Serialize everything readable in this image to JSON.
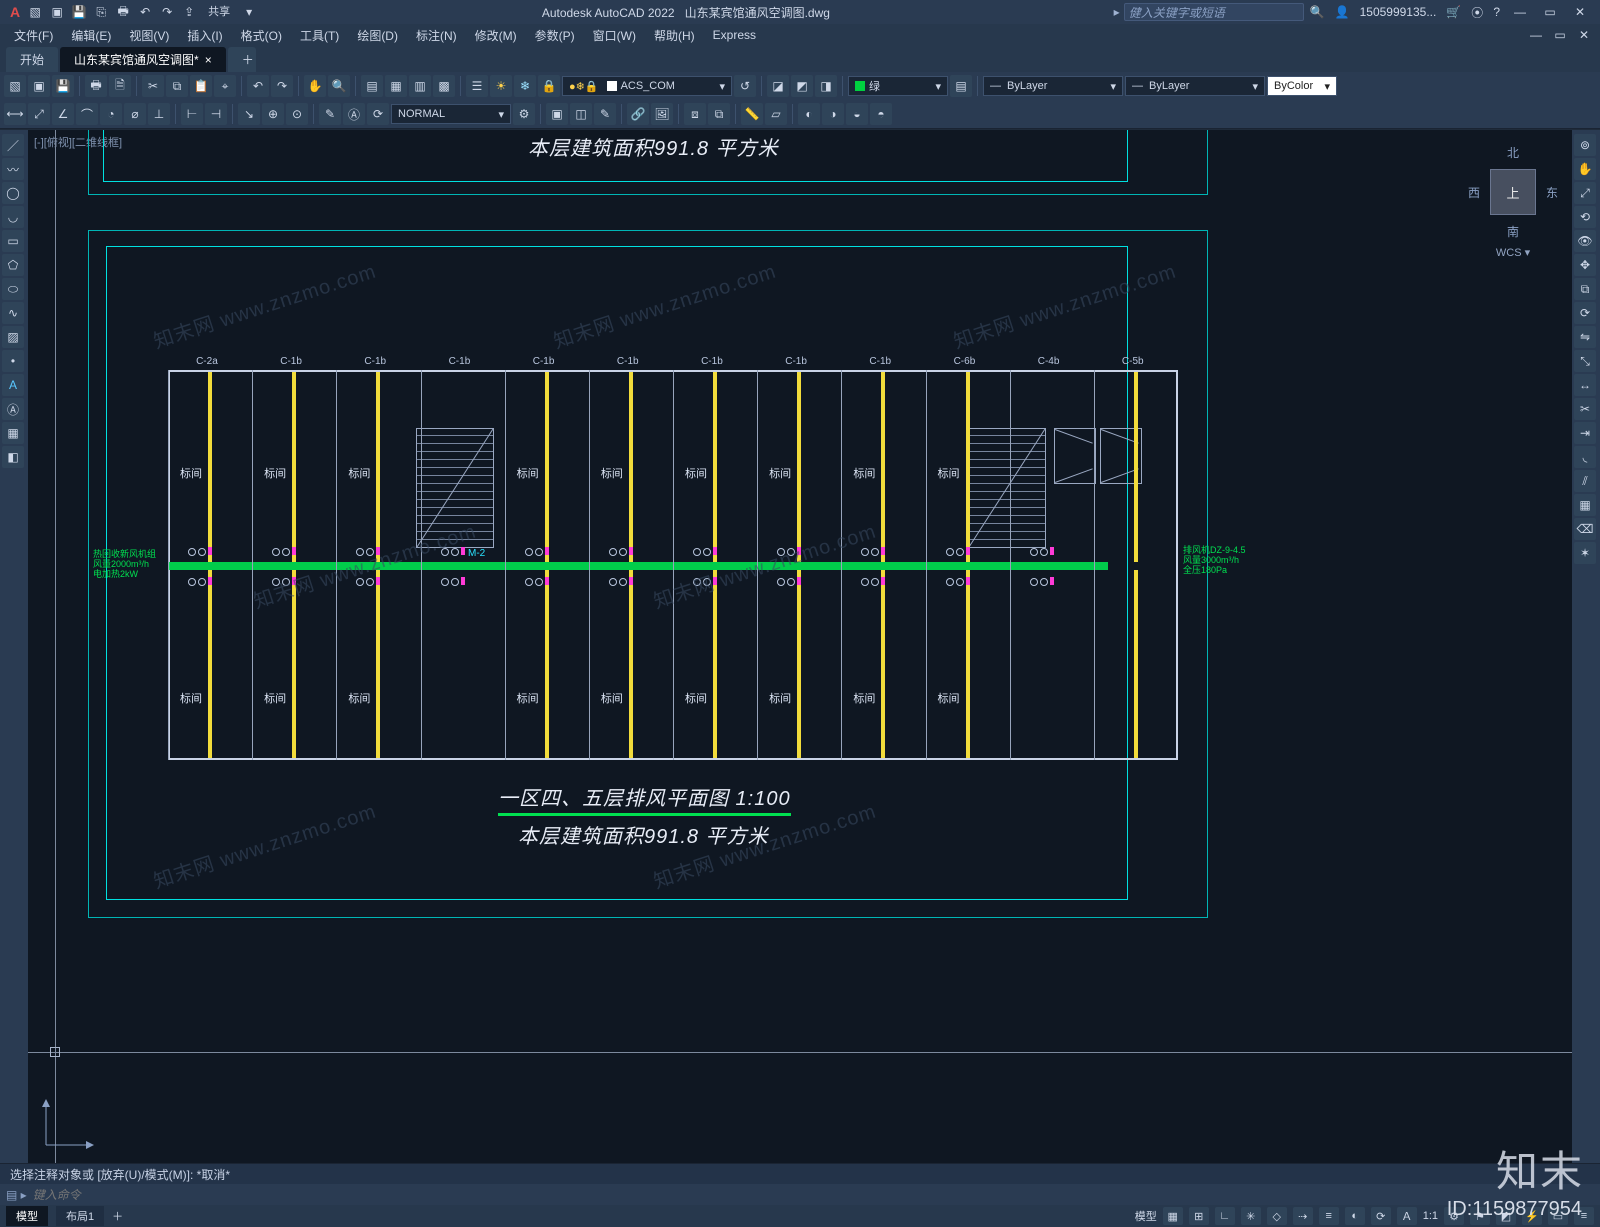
{
  "app": {
    "title": "Autodesk AutoCAD 2022",
    "doc": "山东某宾馆通风空调图.dwg",
    "share": "共享",
    "user": "1505999135..."
  },
  "search": {
    "placeholder": "健入关键字或短语"
  },
  "menu": [
    "文件(F)",
    "编辑(E)",
    "视图(V)",
    "插入(I)",
    "格式(O)",
    "工具(T)",
    "绘图(D)",
    "标注(N)",
    "修改(M)",
    "参数(P)",
    "窗口(W)",
    "帮助(H)",
    "Express"
  ],
  "tabs": {
    "start": "开始",
    "doc": "山东某宾馆通风空调图*"
  },
  "layer": {
    "name": "ACS_COM",
    "color": "#fff"
  },
  "layercolor": "绿",
  "props": {
    "lw": "ByLayer",
    "lt": "ByLayer",
    "col": "ByColor"
  },
  "textstyle": "NORMAL",
  "viewcube": {
    "n": "北",
    "s": "南",
    "e": "东",
    "w": "西",
    "top": "上",
    "wcs": "WCS"
  },
  "canvas_top": {
    "area": "本层建筑面积991.8  平方米"
  },
  "plan": {
    "title": "一区四、五层排风平面图  1:100",
    "area": "本层建筑面积991.8  平方米",
    "c_labels": [
      "C-2a",
      "C-1b",
      "C-1b",
      "C-1b",
      "C-1b",
      "C-1b",
      "C-1b",
      "C-1b",
      "C-1b",
      "C-6b",
      "C-4b",
      "C-5b"
    ],
    "room": "标间",
    "m2": "M-2"
  },
  "cmd": {
    "hist": "选择注释对象或 [放弃(U)/模式(M)]: *取消*",
    "prompt": "键入命令"
  },
  "status": {
    "model": "模型",
    "layout": "布局1",
    "scale": "1:1"
  },
  "watermark": {
    "brand": "知末",
    "id": "ID:1159877954",
    "wm": "知末网 www.znzmo.com"
  }
}
